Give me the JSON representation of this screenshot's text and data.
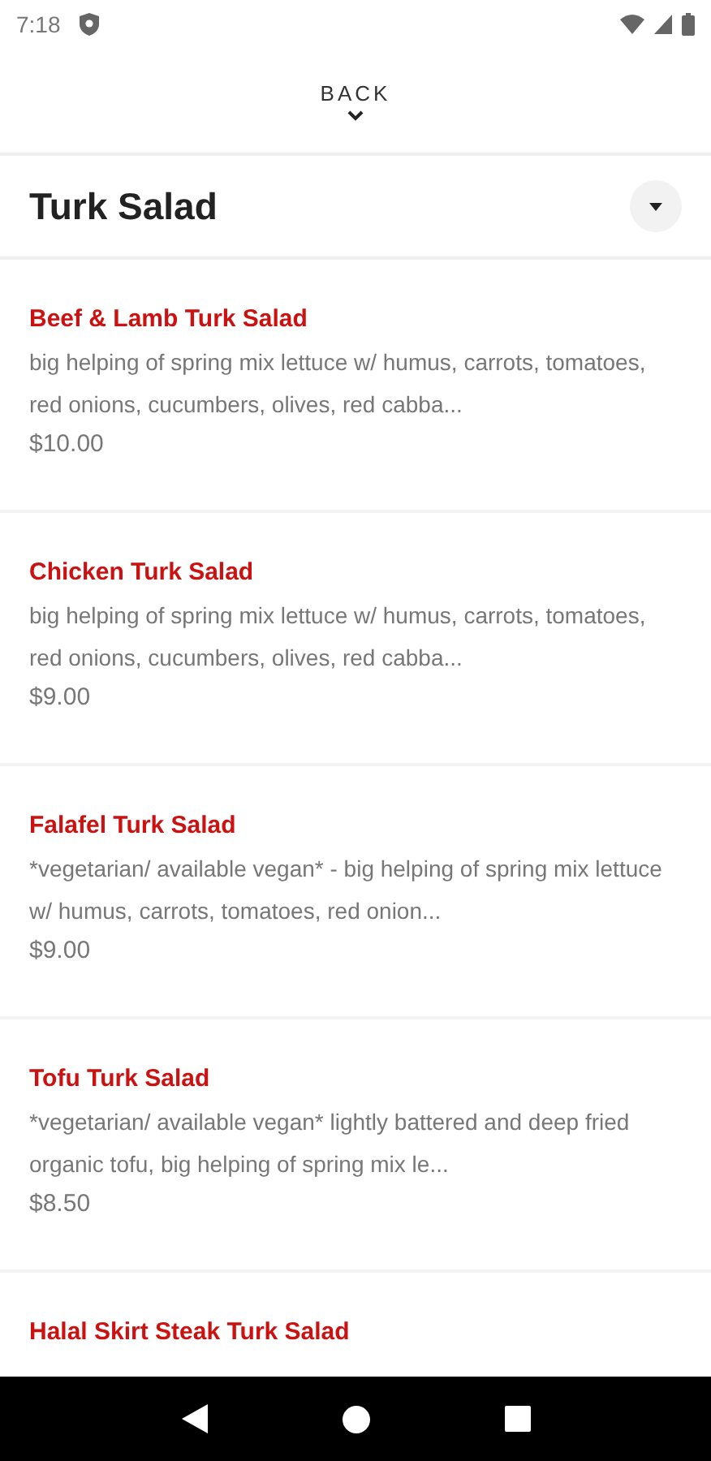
{
  "status_bar": {
    "time": "7:18"
  },
  "back": {
    "label": "BACK"
  },
  "category": {
    "title": "Turk Salad",
    "expanded": true
  },
  "items": [
    {
      "name": "Beef & Lamb Turk Salad",
      "description": "big helping of spring mix lettuce w/ humus, carrots, tomatoes, red onions, cucumbers, olives, red cabba...",
      "price": "$10.00"
    },
    {
      "name": "Chicken Turk Salad",
      "description": "big helping of spring mix lettuce w/ humus, carrots, tomatoes, red onions, cucumbers, olives, red cabba...",
      "price": "$9.00"
    },
    {
      "name": "Falafel Turk Salad",
      "description": "*vegetarian/ available vegan* - big helping of spring mix lettuce w/ humus, carrots, tomatoes, red onion...",
      "price": "$9.00"
    },
    {
      "name": "Tofu Turk Salad",
      "description": "*vegetarian/ available vegan* lightly battered and deep fried organic tofu, big helping of spring mix le...",
      "price": "$8.50"
    },
    {
      "name": "Halal Skirt Steak Turk Salad"
    }
  ]
}
